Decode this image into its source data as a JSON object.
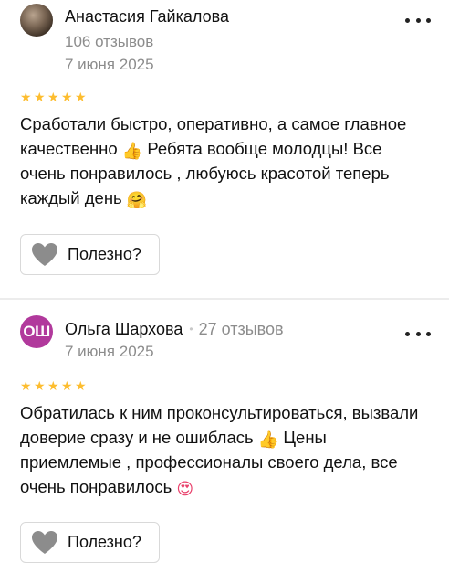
{
  "reviews": [
    {
      "author": "Анастасия Гайкалова",
      "reviews_count": "106 отзывов",
      "date": "7 июня 2025",
      "rating": 5,
      "text_parts": [
        "Сработали быстро, оперативно, а самое главное качественно ",
        " Ребята вообще молодцы! Все очень понравилось , любуюсь красотой теперь каждый день "
      ],
      "emojis": [
        "👍",
        "🤗"
      ],
      "helpful_label": "Полезно?",
      "avatar_icon": "user-photo"
    },
    {
      "author": "Ольга Шархова",
      "separator": "•",
      "reviews_count": "27 отзывов",
      "date": "7 июня 2025",
      "rating": 5,
      "avatar_initials": "ОШ",
      "avatar_color": "#b1399c",
      "text_parts": [
        "Обратилась к ним проконсультироваться, вызвали доверие сразу и не ошиблась ",
        " Цены приемлемые , профессионалы своего дела, все очень понравилось "
      ],
      "emojis": [
        "👍",
        "😍"
      ],
      "helpful_label": "Полезно?"
    }
  ],
  "star_glyph": "★",
  "colors": {
    "star": "#fdbd2f",
    "meta_text": "#8c8c8c",
    "avatar_initials_bg": "#b1399c",
    "heart": "#8c8c8c"
  },
  "icons": {
    "more": "more-dots-icon",
    "heart": "heart-icon",
    "star": "star-icon"
  }
}
